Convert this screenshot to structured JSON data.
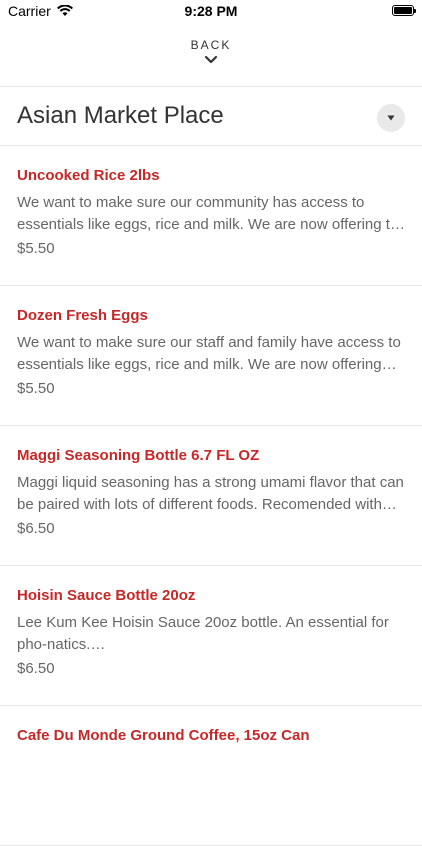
{
  "status_bar": {
    "carrier": "Carrier",
    "time": "9:28 PM"
  },
  "nav": {
    "back_label": "BACK"
  },
  "store": {
    "title": "Asian Market Place"
  },
  "colors": {
    "item_name": "#c62828",
    "text_muted": "#666666",
    "divider": "#e6e6e6"
  },
  "items": [
    {
      "name": "Uncooked Rice 2lbs",
      "description": "We want to make sure our community has access to essentials like eggs, rice and milk. We are now offering t…",
      "price": "$5.50"
    },
    {
      "name": "Dozen Fresh Eggs",
      "description": "We want to make sure our staff and family have access to essentials like eggs, rice and milk. We are now offering o…",
      "price": "$5.50"
    },
    {
      "name": "Maggi Seasoning Bottle 6.7 FL OZ",
      "description": "Maggi liquid seasoning has a strong umami flavor that can be paired with lots of different foods.  Recomended with…",
      "price": "$6.50"
    },
    {
      "name": "Hoisin Sauce Bottle 20oz",
      "description": "Lee Kum Kee Hoisin Sauce 20oz bottle. An essential for pho-natics.…",
      "price": "$6.50"
    },
    {
      "name": "Cafe Du Monde Ground Coffee, 15oz Can",
      "description": "",
      "price": ""
    }
  ]
}
